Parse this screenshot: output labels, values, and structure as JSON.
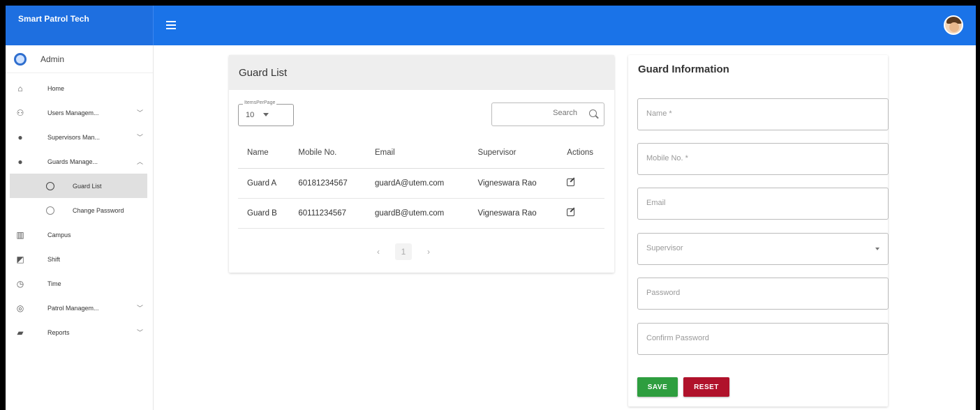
{
  "app": {
    "brand": "Smart Patrol Tech"
  },
  "sidebar": {
    "user_label": "Admin",
    "items": [
      {
        "label": "Home",
        "icon": "home-icon",
        "chevron": ""
      },
      {
        "label": "Users Managem...",
        "icon": "users-icon",
        "chevron": "chevron-down"
      },
      {
        "label": "Supervisors Man...",
        "icon": "person-icon",
        "chevron": "chevron-down"
      },
      {
        "label": "Guards Manage...",
        "icon": "person-icon",
        "chevron": "chevron-up"
      },
      {
        "label": "Guard List",
        "icon": "radio-icon",
        "chevron": ""
      },
      {
        "label": "Change Password",
        "icon": "radio-icon",
        "chevron": ""
      },
      {
        "label": "Campus",
        "icon": "building-icon",
        "chevron": ""
      },
      {
        "label": "Shift",
        "icon": "shift-icon",
        "chevron": ""
      },
      {
        "label": "Time",
        "icon": "timer-icon",
        "chevron": ""
      },
      {
        "label": "Patrol Managem...",
        "icon": "radar-icon",
        "chevron": "chevron-down"
      },
      {
        "label": "Reports",
        "icon": "folder-icon",
        "chevron": "chevron-down"
      }
    ]
  },
  "guard_list": {
    "title": "Guard List",
    "items_per_page_label": "ItemsPerPage",
    "items_per_page_value": "10",
    "search_placeholder": "Search",
    "columns": [
      "Name",
      "Mobile No.",
      "Email",
      "Supervisor",
      "Actions"
    ],
    "rows": [
      {
        "name": "Guard A",
        "mobile": "60181234567",
        "email": "guardA@utem.com",
        "supervisor": "Vigneswara Rao"
      },
      {
        "name": "Guard B",
        "mobile": "60111234567",
        "email": "guardB@utem.com",
        "supervisor": "Vigneswara Rao"
      }
    ],
    "pagination": {
      "prev": "‹",
      "current": "1",
      "next": "›"
    }
  },
  "guard_info": {
    "title": "Guard Information",
    "fields": {
      "name": "Name *",
      "mobile": "Mobile No. *",
      "email": "Email",
      "supervisor": "Supervisor",
      "password": "Password",
      "confirm_password": "Confirm Password"
    },
    "save_label": "SAVE",
    "reset_label": "RESET"
  },
  "colors": {
    "topbar": "#1a73e8",
    "save": "#2e9e3f",
    "reset": "#b0122b"
  }
}
